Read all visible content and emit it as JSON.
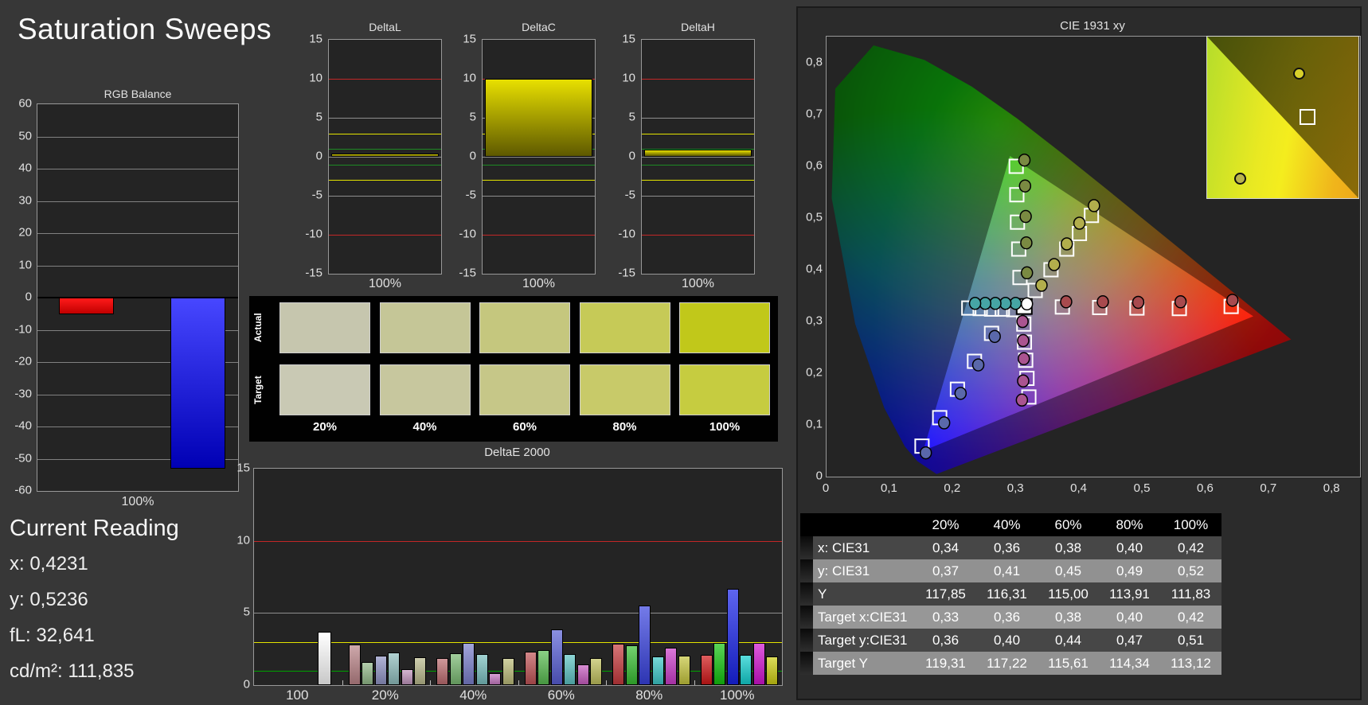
{
  "page": {
    "title": "Saturation Sweeps"
  },
  "current_reading": {
    "heading": "Current Reading",
    "values": [
      "x: 0,4231",
      "y: 0,5236",
      "fL: 32,641",
      "cd/m²: 111,835"
    ]
  },
  "chart_data": [
    {
      "id": "rgb_balance",
      "type": "bar",
      "title": "RGB Balance",
      "xlabel": "100%",
      "ylim": [
        -60,
        60
      ],
      "ytick_step": 10,
      "grid": true,
      "series": [
        {
          "name": "red",
          "value": -5.2,
          "color_top": "#ff1a1a",
          "color_bottom": "#c00000"
        },
        {
          "name": "green",
          "value": 0,
          "color_top": "#22cc22",
          "color_bottom": "#008800"
        },
        {
          "name": "blue",
          "value": -53,
          "color_top": "#4747ff",
          "color_bottom": "#0000b4"
        }
      ]
    },
    {
      "id": "deltaL",
      "type": "bar",
      "title": "DeltaL",
      "xlabel": "100%",
      "ylim": [
        -15,
        15
      ],
      "yticks": [
        15,
        10,
        5,
        0,
        -5,
        -10,
        -15
      ],
      "value": 0.4,
      "bar_color_top": "#e8e000",
      "bar_color_bottom": "#5e5900",
      "ref_lines": [
        {
          "v": 10,
          "color": "#c32727"
        },
        {
          "v": 5,
          "color": "#8f8f8f"
        },
        {
          "v": 3,
          "color": "#e3e300"
        },
        {
          "v": 1,
          "color": "#1d8a24"
        },
        {
          "v": 0,
          "color": "#8f8f8f"
        },
        {
          "v": -1,
          "color": "#1d8a24"
        },
        {
          "v": -3,
          "color": "#e3e300"
        },
        {
          "v": -5,
          "color": "#8f8f8f"
        },
        {
          "v": -10,
          "color": "#c32727"
        }
      ]
    },
    {
      "id": "deltaC",
      "type": "bar",
      "title": "DeltaC",
      "xlabel": "100%",
      "ylim": [
        -15,
        15
      ],
      "yticks": [
        15,
        10,
        5,
        0,
        -5,
        -10,
        -15
      ],
      "value": 10,
      "bar_color_top": "#e8e000",
      "bar_color_bottom": "#5e5900",
      "ref_lines": [
        {
          "v": 10,
          "color": "#c32727"
        },
        {
          "v": 5,
          "color": "#8f8f8f"
        },
        {
          "v": 3,
          "color": "#e3e300"
        },
        {
          "v": 1,
          "color": "#1d8a24"
        },
        {
          "v": 0,
          "color": "#8f8f8f"
        },
        {
          "v": -1,
          "color": "#1d8a24"
        },
        {
          "v": -3,
          "color": "#e3e300"
        },
        {
          "v": -5,
          "color": "#8f8f8f"
        },
        {
          "v": -10,
          "color": "#c32727"
        }
      ]
    },
    {
      "id": "deltaH",
      "type": "bar",
      "title": "DeltaH",
      "xlabel": "100%",
      "ylim": [
        -15,
        15
      ],
      "yticks": [
        15,
        10,
        5,
        0,
        -5,
        -10,
        -15
      ],
      "value": 0.9,
      "bar_color_top": "#e8e000",
      "bar_color_bottom": "#5e5900",
      "ref_lines": [
        {
          "v": 10,
          "color": "#c32727"
        },
        {
          "v": 5,
          "color": "#8f8f8f"
        },
        {
          "v": 3,
          "color": "#e3e300"
        },
        {
          "v": 1,
          "color": "#1d8a24"
        },
        {
          "v": 0,
          "color": "#8f8f8f"
        },
        {
          "v": -1,
          "color": "#1d8a24"
        },
        {
          "v": -3,
          "color": "#e3e300"
        },
        {
          "v": -5,
          "color": "#8f8f8f"
        },
        {
          "v": -10,
          "color": "#c32727"
        }
      ]
    },
    {
      "id": "deltaE2000",
      "type": "bar",
      "title": "DeltaE 2000",
      "ylim": [
        0,
        15
      ],
      "yticks": [
        15,
        10,
        5,
        0
      ],
      "ref_lines": [
        {
          "v": 10,
          "color": "#c32727"
        },
        {
          "v": 5,
          "color": "#8f8f8f"
        },
        {
          "v": 3,
          "color": "#e3e300"
        },
        {
          "v": 1,
          "color": "#00a200"
        }
      ],
      "groups": [
        {
          "label": "100",
          "values": [
            3.7
          ],
          "colors": [
            "#f4f4f4"
          ]
        },
        {
          "label": "20%",
          "values": [
            2.8,
            1.6,
            2.05,
            2.25,
            1.1,
            1.95
          ],
          "colors": [
            "#b98387",
            "#92b989",
            "#8f93c3",
            "#8fbdbd",
            "#c095bd",
            "#b9b98c"
          ]
        },
        {
          "label": "40%",
          "values": [
            1.9,
            2.2,
            2.95,
            2.15,
            0.85,
            1.85
          ],
          "colors": [
            "#bb6b6f",
            "#79b971",
            "#7a7fcc",
            "#79bfbf",
            "#c679c2",
            "#bbbb79"
          ]
        },
        {
          "label": "60%",
          "values": [
            2.3,
            2.4,
            3.85,
            2.15,
            1.45,
            1.85
          ],
          "colors": [
            "#c05356",
            "#58bb50",
            "#585fd5",
            "#5cc3c3",
            "#c75cc0",
            "#bfbf5c"
          ]
        },
        {
          "label": "80%",
          "values": [
            2.85,
            2.75,
            5.5,
            2.0,
            2.6,
            2.05
          ],
          "colors": [
            "#c63a3d",
            "#37bd31",
            "#3842de",
            "#3cc8c8",
            "#cb3cc9",
            "#c4c43c"
          ]
        },
        {
          "label": "100%",
          "values": [
            2.1,
            2.95,
            6.7,
            2.1,
            2.95,
            2.0
          ],
          "colors": [
            "#d01718",
            "#14c40f",
            "#1823e8",
            "#12cfcf",
            "#d013d0",
            "#cccc12"
          ]
        }
      ]
    },
    {
      "id": "cie1931",
      "type": "scatter",
      "title": "CIE 1931 xy",
      "xlim": [
        0,
        0.84
      ],
      "ylim": [
        0,
        0.85
      ],
      "xticks": [
        "0",
        "0,1",
        "0,2",
        "0,3",
        "0,4",
        "0,5",
        "0,6",
        "0,7",
        "0,8"
      ],
      "yticks": [
        "0",
        "0,1",
        "0,2",
        "0,3",
        "0,4",
        "0,5",
        "0,6",
        "0,7",
        "0,8"
      ],
      "sweeps": [
        {
          "name": "red",
          "marker_color": "#a84a4e",
          "targets": [
            [
              0.373,
              0.328
            ],
            [
              0.432,
              0.327
            ],
            [
              0.491,
              0.326
            ],
            [
              0.558,
              0.325
            ],
            [
              0.64,
              0.329
            ]
          ],
          "measured": [
            [
              0.379,
              0.338
            ],
            [
              0.437,
              0.338
            ],
            [
              0.493,
              0.337
            ],
            [
              0.56,
              0.338
            ],
            [
              0.642,
              0.341
            ]
          ]
        },
        {
          "name": "green",
          "marker_color": "#7a8a42",
          "targets": [
            [
              0.306,
              0.385
            ],
            [
              0.304,
              0.44
            ],
            [
              0.302,
              0.492
            ],
            [
              0.301,
              0.545
            ],
            [
              0.3,
              0.6
            ]
          ],
          "measured": [
            [
              0.317,
              0.394
            ],
            [
              0.316,
              0.452
            ],
            [
              0.315,
              0.503
            ],
            [
              0.314,
              0.562
            ],
            [
              0.313,
              0.612
            ]
          ]
        },
        {
          "name": "blue",
          "marker_color": "#5a68aa",
          "targets": [
            [
              0.261,
              0.277
            ],
            [
              0.234,
              0.223
            ],
            [
              0.207,
              0.169
            ],
            [
              0.179,
              0.114
            ],
            [
              0.151,
              0.059
            ]
          ],
          "measured": [
            [
              0.266,
              0.271
            ],
            [
              0.24,
              0.216
            ],
            [
              0.212,
              0.161
            ],
            [
              0.186,
              0.104
            ],
            [
              0.157,
              0.046
            ]
          ]
        },
        {
          "name": "cyan",
          "marker_color": "#46a5a5",
          "targets": [
            [
              0.296,
              0.323
            ],
            [
              0.278,
              0.324
            ],
            [
              0.261,
              0.324
            ],
            [
              0.243,
              0.325
            ],
            [
              0.225,
              0.326
            ]
          ],
          "measured": [
            [
              0.299,
              0.335
            ],
            [
              0.283,
              0.335
            ],
            [
              0.267,
              0.335
            ],
            [
              0.251,
              0.335
            ],
            [
              0.235,
              0.335
            ]
          ]
        },
        {
          "name": "magenta",
          "marker_color": "#aa5490",
          "targets": [
            [
              0.312,
              0.295
            ],
            [
              0.313,
              0.26
            ],
            [
              0.315,
              0.225
            ],
            [
              0.317,
              0.19
            ],
            [
              0.32,
              0.154
            ]
          ],
          "measured": [
            [
              0.31,
              0.3
            ],
            [
              0.311,
              0.263
            ],
            [
              0.312,
              0.228
            ],
            [
              0.311,
              0.185
            ],
            [
              0.309,
              0.148
            ]
          ]
        },
        {
          "name": "yellow",
          "marker_color": "#b2ae4c",
          "targets": [
            [
              0.33,
              0.36
            ],
            [
              0.355,
              0.4
            ],
            [
              0.38,
              0.44
            ],
            [
              0.4,
              0.47
            ],
            [
              0.419,
              0.505
            ]
          ],
          "measured": [
            [
              0.34,
              0.37
            ],
            [
              0.36,
              0.41
            ],
            [
              0.38,
              0.45
            ],
            [
              0.4,
              0.49
            ],
            [
              0.423,
              0.524
            ]
          ]
        }
      ],
      "white_point": {
        "target": [
          0.3127,
          0.329
        ],
        "measured": [
          0.317,
          0.334
        ]
      },
      "inset": {
        "markers": [
          {
            "type": "circle",
            "x": 0.57,
            "y": 0.19,
            "color": "#d8d02b"
          },
          {
            "type": "square",
            "x": 0.61,
            "y": 0.45
          },
          {
            "type": "circle",
            "x": 0.18,
            "y": 0.84,
            "color": "#b9b34d"
          }
        ]
      }
    }
  ],
  "swatch_panel": {
    "row_labels": [
      "Actual",
      "Target"
    ],
    "column_labels": [
      "20%",
      "40%",
      "60%",
      "80%",
      "100%"
    ],
    "actual_colors": [
      "#c6c6ae",
      "#c5c697",
      "#c5c77e",
      "#c6ca57",
      "#c1c81a"
    ],
    "target_colors": [
      "#c9c9b4",
      "#c7c79e",
      "#c6c788",
      "#c8ca69",
      "#c6cc40"
    ]
  },
  "table": {
    "header": [
      "20%",
      "40%",
      "60%",
      "80%",
      "100%"
    ],
    "rows": [
      {
        "label": "x: CIE31",
        "values": [
          "0,34",
          "0,36",
          "0,38",
          "0,40",
          "0,42"
        ]
      },
      {
        "label": "y: CIE31",
        "values": [
          "0,37",
          "0,41",
          "0,45",
          "0,49",
          "0,52"
        ]
      },
      {
        "label": "Y",
        "values": [
          "117,85",
          "116,31",
          "115,00",
          "113,91",
          "111,83"
        ]
      },
      {
        "label": "Target x:CIE31",
        "values": [
          "0,33",
          "0,36",
          "0,38",
          "0,40",
          "0,42"
        ]
      },
      {
        "label": "Target y:CIE31",
        "values": [
          "0,36",
          "0,40",
          "0,44",
          "0,47",
          "0,51"
        ]
      },
      {
        "label": "Target Y",
        "values": [
          "119,31",
          "117,22",
          "115,61",
          "114,34",
          "113,12"
        ]
      }
    ],
    "row_colors": [
      "#474747",
      "#919191",
      "#434343",
      "#979797",
      "#474747",
      "#919191"
    ]
  }
}
